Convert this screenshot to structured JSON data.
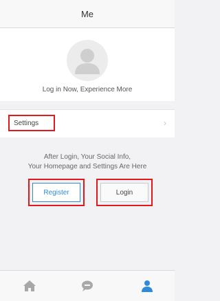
{
  "header": {
    "title": "Me"
  },
  "profile": {
    "prompt": "Log in Now, Experience More"
  },
  "settings": {
    "label": "Settings",
    "chevron": "›"
  },
  "login_area": {
    "line1": "After Login, Your Social Info,",
    "line2": "Your Homepage and Settings Are Here",
    "register_label": "Register",
    "login_label": "Login"
  },
  "tabbar": {
    "tabs": [
      {
        "icon": "home-icon",
        "active": false
      },
      {
        "icon": "chat-bubble-icon",
        "active": false
      },
      {
        "icon": "person-icon",
        "active": true
      }
    ]
  },
  "colors": {
    "accent": "#2f8bd8",
    "highlight_border": "#e0191e",
    "inactive_icon": "#a8a8a8"
  }
}
